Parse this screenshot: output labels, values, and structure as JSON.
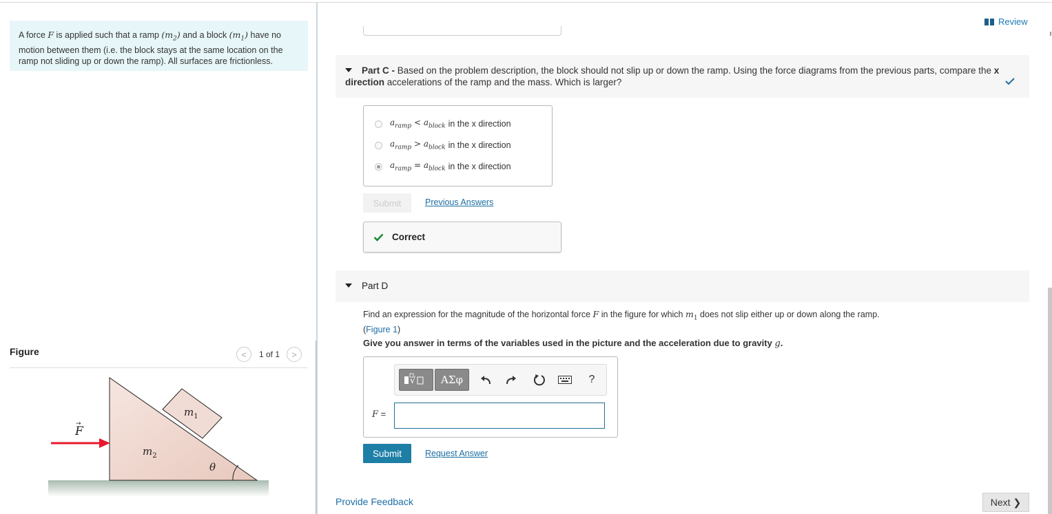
{
  "problem": {
    "line1_pre": "A force ",
    "var_F": "F",
    "line1_mid": " is applied such that a ramp ",
    "var_m2": "(m",
    "sub2": "2",
    "close": ")",
    "line1_and": " and a block ",
    "var_m1": "(m",
    "sub1": "1",
    "line1_post": " have no motion between them (i.e. the block stays at the same location on the ramp not sliding up or down the ramp).  All surfaces are frictionless."
  },
  "figure": {
    "title": "Figure",
    "count": "1 of 1",
    "prev_glyph": "<",
    "next_glyph": ">",
    "label_F": "F",
    "label_m1": "m",
    "label_m1_sub": "1",
    "label_m2": "m",
    "label_m2_sub": "2",
    "label_theta": "θ",
    "colors": {
      "arrow": "#e8192c",
      "ramp_fill": "#f1dcd5",
      "ground": "#b7c6bd"
    }
  },
  "header": {
    "review_label": "Review"
  },
  "part_c": {
    "label": "Part C - ",
    "text_pre": "Based on the problem description, the block should not slip up or down the ramp.  Using the force diagrams from the previous parts, compare the ",
    "text_bold": "x direction",
    "text_post": " accelerations of the ramp and the mass.  Which is larger?",
    "options": [
      {
        "a": "a",
        "sub_a": "ramp",
        "op": "<",
        "b": "a",
        "sub_b": "block",
        "suffix": "in the x direction",
        "selected": false
      },
      {
        "a": "a",
        "sub_a": "ramp",
        "op": ">",
        "b": "a",
        "sub_b": "block",
        "suffix": "in the x direction",
        "selected": false
      },
      {
        "a": "a",
        "sub_a": "ramp",
        "op": "=",
        "b": "a",
        "sub_b": "block",
        "suffix": "in the x direction",
        "selected": true
      }
    ],
    "submit_label": "Submit",
    "previous_answers_label": "Previous Answers",
    "feedback_label": "Correct",
    "status_color": "#1f8a36"
  },
  "part_d": {
    "label": "Part D",
    "text1_pre": "Find an expression for the magnitude of the horizontal force ",
    "text1_var": "F",
    "text1_mid": " in the figure for which ",
    "text1_var2": "m",
    "text1_sub2": "1",
    "text1_post": " does not slip either up or down along the ramp.",
    "figure_link": "Figure 1",
    "give_text": "Give you answer in terms of the variables used in the picture and the acceleration due to gravity ",
    "give_var": "g",
    "give_end": ".",
    "toolbar": {
      "greek_label": "ΑΣφ",
      "help_label": "?",
      "undo_glyph": "↶",
      "redo_glyph": "↷",
      "reset_glyph": "↻"
    },
    "input_label": "F =",
    "input_value": "",
    "submit_label": "Submit",
    "request_answer_label": "Request Answer"
  },
  "footer": {
    "feedback_label": "Provide Feedback",
    "next_label": "Next",
    "next_glyph": "❯"
  }
}
